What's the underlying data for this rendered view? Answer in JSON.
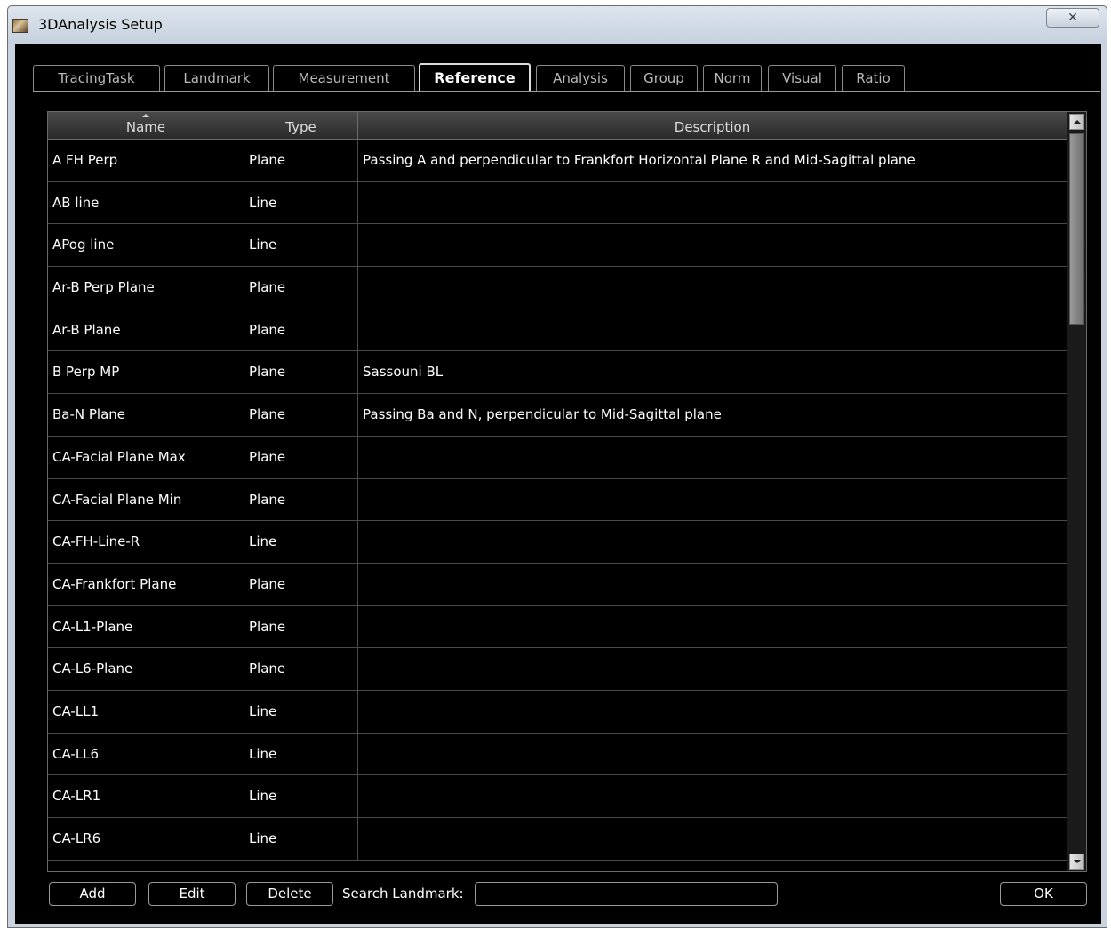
{
  "window": {
    "title": "3DAnalysis Setup",
    "close_glyph": "✕"
  },
  "tabs": [
    {
      "label": "TracingTask",
      "active": false
    },
    {
      "label": "Landmark",
      "active": false
    },
    {
      "label": "Measurement",
      "active": false
    },
    {
      "label": "Reference",
      "active": true
    },
    {
      "label": "Analysis",
      "active": false
    },
    {
      "label": "Group",
      "active": false
    },
    {
      "label": "Norm",
      "active": false
    },
    {
      "label": "Visual",
      "active": false
    },
    {
      "label": "Ratio",
      "active": false
    }
  ],
  "table": {
    "columns": [
      "Name",
      "Type",
      "Description"
    ],
    "sort_column": "Name",
    "rows": [
      {
        "name": "A FH Perp",
        "type": "Plane",
        "description": "Passing A and perpendicular to Frankfort Horizontal Plane R and Mid-Sagittal plane"
      },
      {
        "name": "AB line",
        "type": "Line",
        "description": ""
      },
      {
        "name": "APog line",
        "type": "Line",
        "description": ""
      },
      {
        "name": "Ar-B Perp Plane",
        "type": "Plane",
        "description": ""
      },
      {
        "name": "Ar-B Plane",
        "type": "Plane",
        "description": ""
      },
      {
        "name": "B Perp MP",
        "type": "Plane",
        "description": "Sassouni BL"
      },
      {
        "name": "Ba-N Plane",
        "type": "Plane",
        "description": "Passing Ba and N, perpendicular to Mid-Sagittal plane"
      },
      {
        "name": "CA-Facial Plane Max",
        "type": "Plane",
        "description": ""
      },
      {
        "name": "CA-Facial Plane Min",
        "type": "Plane",
        "description": ""
      },
      {
        "name": "CA-FH-Line-R",
        "type": "Line",
        "description": ""
      },
      {
        "name": "CA-Frankfort Plane",
        "type": "Plane",
        "description": ""
      },
      {
        "name": "CA-L1-Plane",
        "type": "Plane",
        "description": ""
      },
      {
        "name": "CA-L6-Plane",
        "type": "Plane",
        "description": ""
      },
      {
        "name": "CA-LL1",
        "type": "Line",
        "description": ""
      },
      {
        "name": "CA-LL6",
        "type": "Line",
        "description": ""
      },
      {
        "name": "CA-LR1",
        "type": "Line",
        "description": ""
      },
      {
        "name": "CA-LR6",
        "type": "Line",
        "description": ""
      }
    ]
  },
  "buttons": {
    "add": "Add",
    "edit": "Edit",
    "delete": "Delete",
    "ok": "OK"
  },
  "search": {
    "label": "Search Landmark:",
    "value": ""
  }
}
